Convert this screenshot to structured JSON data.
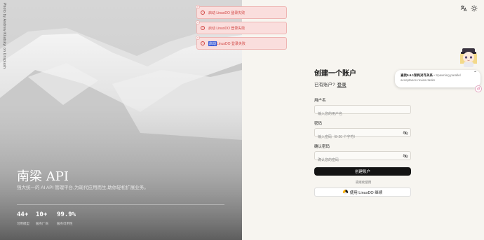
{
  "hero": {
    "credit": "Photo by Andrew Kliatskyi on Unsplash",
    "title": "南梁 API",
    "description": "强大统一的 AI API 管理平台,为现代应用而生,助你轻松扩展业务。",
    "stats": [
      {
        "value": "44+",
        "label": "可用模型"
      },
      {
        "value": "10+",
        "label": "服务厂商"
      },
      {
        "value": "99.9%",
        "label": "服务可用性"
      }
    ]
  },
  "topbar": {
    "translate_icon": "translate-icon",
    "theme_icon": "sun-icon"
  },
  "toasts": [
    {
      "text": "启动 LinuxDO 登录失败",
      "highlight": ""
    },
    {
      "text": "启动 LinuxDO 登录失败",
      "highlight": ""
    },
    {
      "text": " LinuxDO 登录失败",
      "highlight": "启动"
    }
  ],
  "form": {
    "title": "创建一个账户",
    "have_account": "已有账户?",
    "login_link": "登录",
    "username_label": "用户名",
    "username_placeholder": "输入您的用户名",
    "password_label": "密码",
    "password_placeholder": "输入密码（8-20 个字符）",
    "confirm_label": "确认密码",
    "confirm_placeholder": "确认您的密码",
    "submit": "创建账户",
    "divider": "或继续使用",
    "linuxdo_button": "使用 LinuxDO 继续"
  },
  "notification": {
    "title": "查找5.6.1架构对齐关系",
    "body": " • Spawning parallel acceptance review tasks"
  },
  "colors": {
    "toast_bg": "#fadedd",
    "toast_text": "#d04442",
    "button_dark": "#141414",
    "background": "#f7f5f0"
  }
}
